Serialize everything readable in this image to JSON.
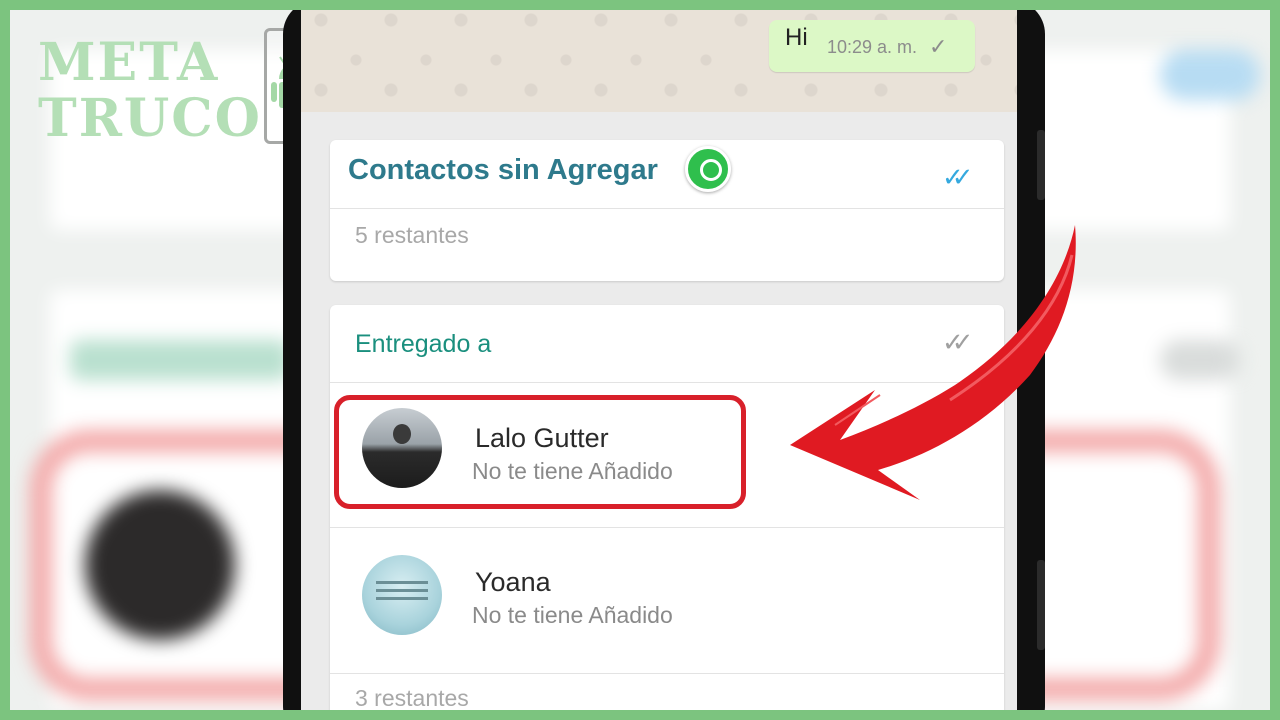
{
  "watermark": {
    "line1": "META",
    "line2": "TRUCO",
    "icon": "android-icon"
  },
  "chat": {
    "message": "Hi",
    "time": "10:29 a. m.",
    "status_icon": "single-check-icon"
  },
  "card_unsaved": {
    "title": "Contactos sin Agregar",
    "icon": "whatsapp-icon",
    "check_icon": "double-check-blue-icon",
    "remaining": "5 restantes"
  },
  "card_delivered": {
    "title": "Entregado a",
    "check_icon": "double-check-gray-icon",
    "contacts": [
      {
        "name": "Lalo Gutter",
        "status": "No te tiene Añadido"
      },
      {
        "name": "Yoana",
        "status": "No te tiene Añadido"
      }
    ],
    "remaining": "3 restantes"
  },
  "colors": {
    "frame_border": "#7cc47f",
    "highlight": "#d8202a",
    "arrow": "#e01a22",
    "title_teal": "#2e7a8c",
    "delivered_teal": "#1a8f7e",
    "read_check": "#35a9df",
    "bubble_green": "#dcf8c6"
  }
}
